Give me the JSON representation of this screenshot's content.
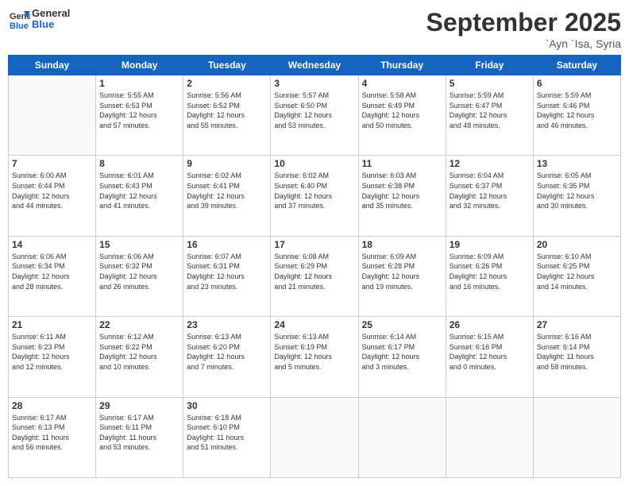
{
  "logo": {
    "line1": "General",
    "line2": "Blue"
  },
  "title": "September 2025",
  "location": "`Ayn `Isa, Syria",
  "weekdays": [
    "Sunday",
    "Monday",
    "Tuesday",
    "Wednesday",
    "Thursday",
    "Friday",
    "Saturday"
  ],
  "weeks": [
    [
      {
        "day": "",
        "info": ""
      },
      {
        "day": "1",
        "info": "Sunrise: 5:55 AM\nSunset: 6:53 PM\nDaylight: 12 hours\nand 57 minutes."
      },
      {
        "day": "2",
        "info": "Sunrise: 5:56 AM\nSunset: 6:52 PM\nDaylight: 12 hours\nand 55 minutes."
      },
      {
        "day": "3",
        "info": "Sunrise: 5:57 AM\nSunset: 6:50 PM\nDaylight: 12 hours\nand 53 minutes."
      },
      {
        "day": "4",
        "info": "Sunrise: 5:58 AM\nSunset: 6:49 PM\nDaylight: 12 hours\nand 50 minutes."
      },
      {
        "day": "5",
        "info": "Sunrise: 5:59 AM\nSunset: 6:47 PM\nDaylight: 12 hours\nand 48 minutes."
      },
      {
        "day": "6",
        "info": "Sunrise: 5:59 AM\nSunset: 6:46 PM\nDaylight: 12 hours\nand 46 minutes."
      }
    ],
    [
      {
        "day": "7",
        "info": "Sunrise: 6:00 AM\nSunset: 6:44 PM\nDaylight: 12 hours\nand 44 minutes."
      },
      {
        "day": "8",
        "info": "Sunrise: 6:01 AM\nSunset: 6:43 PM\nDaylight: 12 hours\nand 41 minutes."
      },
      {
        "day": "9",
        "info": "Sunrise: 6:02 AM\nSunset: 6:41 PM\nDaylight: 12 hours\nand 39 minutes."
      },
      {
        "day": "10",
        "info": "Sunrise: 6:02 AM\nSunset: 6:40 PM\nDaylight: 12 hours\nand 37 minutes."
      },
      {
        "day": "11",
        "info": "Sunrise: 6:03 AM\nSunset: 6:38 PM\nDaylight: 12 hours\nand 35 minutes."
      },
      {
        "day": "12",
        "info": "Sunrise: 6:04 AM\nSunset: 6:37 PM\nDaylight: 12 hours\nand 32 minutes."
      },
      {
        "day": "13",
        "info": "Sunrise: 6:05 AM\nSunset: 6:35 PM\nDaylight: 12 hours\nand 30 minutes."
      }
    ],
    [
      {
        "day": "14",
        "info": "Sunrise: 6:06 AM\nSunset: 6:34 PM\nDaylight: 12 hours\nand 28 minutes."
      },
      {
        "day": "15",
        "info": "Sunrise: 6:06 AM\nSunset: 6:32 PM\nDaylight: 12 hours\nand 26 minutes."
      },
      {
        "day": "16",
        "info": "Sunrise: 6:07 AM\nSunset: 6:31 PM\nDaylight: 12 hours\nand 23 minutes."
      },
      {
        "day": "17",
        "info": "Sunrise: 6:08 AM\nSunset: 6:29 PM\nDaylight: 12 hours\nand 21 minutes."
      },
      {
        "day": "18",
        "info": "Sunrise: 6:09 AM\nSunset: 6:28 PM\nDaylight: 12 hours\nand 19 minutes."
      },
      {
        "day": "19",
        "info": "Sunrise: 6:09 AM\nSunset: 6:26 PM\nDaylight: 12 hours\nand 16 minutes."
      },
      {
        "day": "20",
        "info": "Sunrise: 6:10 AM\nSunset: 6:25 PM\nDaylight: 12 hours\nand 14 minutes."
      }
    ],
    [
      {
        "day": "21",
        "info": "Sunrise: 6:11 AM\nSunset: 6:23 PM\nDaylight: 12 hours\nand 12 minutes."
      },
      {
        "day": "22",
        "info": "Sunrise: 6:12 AM\nSunset: 6:22 PM\nDaylight: 12 hours\nand 10 minutes."
      },
      {
        "day": "23",
        "info": "Sunrise: 6:13 AM\nSunset: 6:20 PM\nDaylight: 12 hours\nand 7 minutes."
      },
      {
        "day": "24",
        "info": "Sunrise: 6:13 AM\nSunset: 6:19 PM\nDaylight: 12 hours\nand 5 minutes."
      },
      {
        "day": "25",
        "info": "Sunrise: 6:14 AM\nSunset: 6:17 PM\nDaylight: 12 hours\nand 3 minutes."
      },
      {
        "day": "26",
        "info": "Sunrise: 6:15 AM\nSunset: 6:16 PM\nDaylight: 12 hours\nand 0 minutes."
      },
      {
        "day": "27",
        "info": "Sunrise: 6:16 AM\nSunset: 6:14 PM\nDaylight: 11 hours\nand 58 minutes."
      }
    ],
    [
      {
        "day": "28",
        "info": "Sunrise: 6:17 AM\nSunset: 6:13 PM\nDaylight: 11 hours\nand 56 minutes."
      },
      {
        "day": "29",
        "info": "Sunrise: 6:17 AM\nSunset: 6:11 PM\nDaylight: 11 hours\nand 53 minutes."
      },
      {
        "day": "30",
        "info": "Sunrise: 6:18 AM\nSunset: 6:10 PM\nDaylight: 11 hours\nand 51 minutes."
      },
      {
        "day": "",
        "info": ""
      },
      {
        "day": "",
        "info": ""
      },
      {
        "day": "",
        "info": ""
      },
      {
        "day": "",
        "info": ""
      }
    ]
  ]
}
